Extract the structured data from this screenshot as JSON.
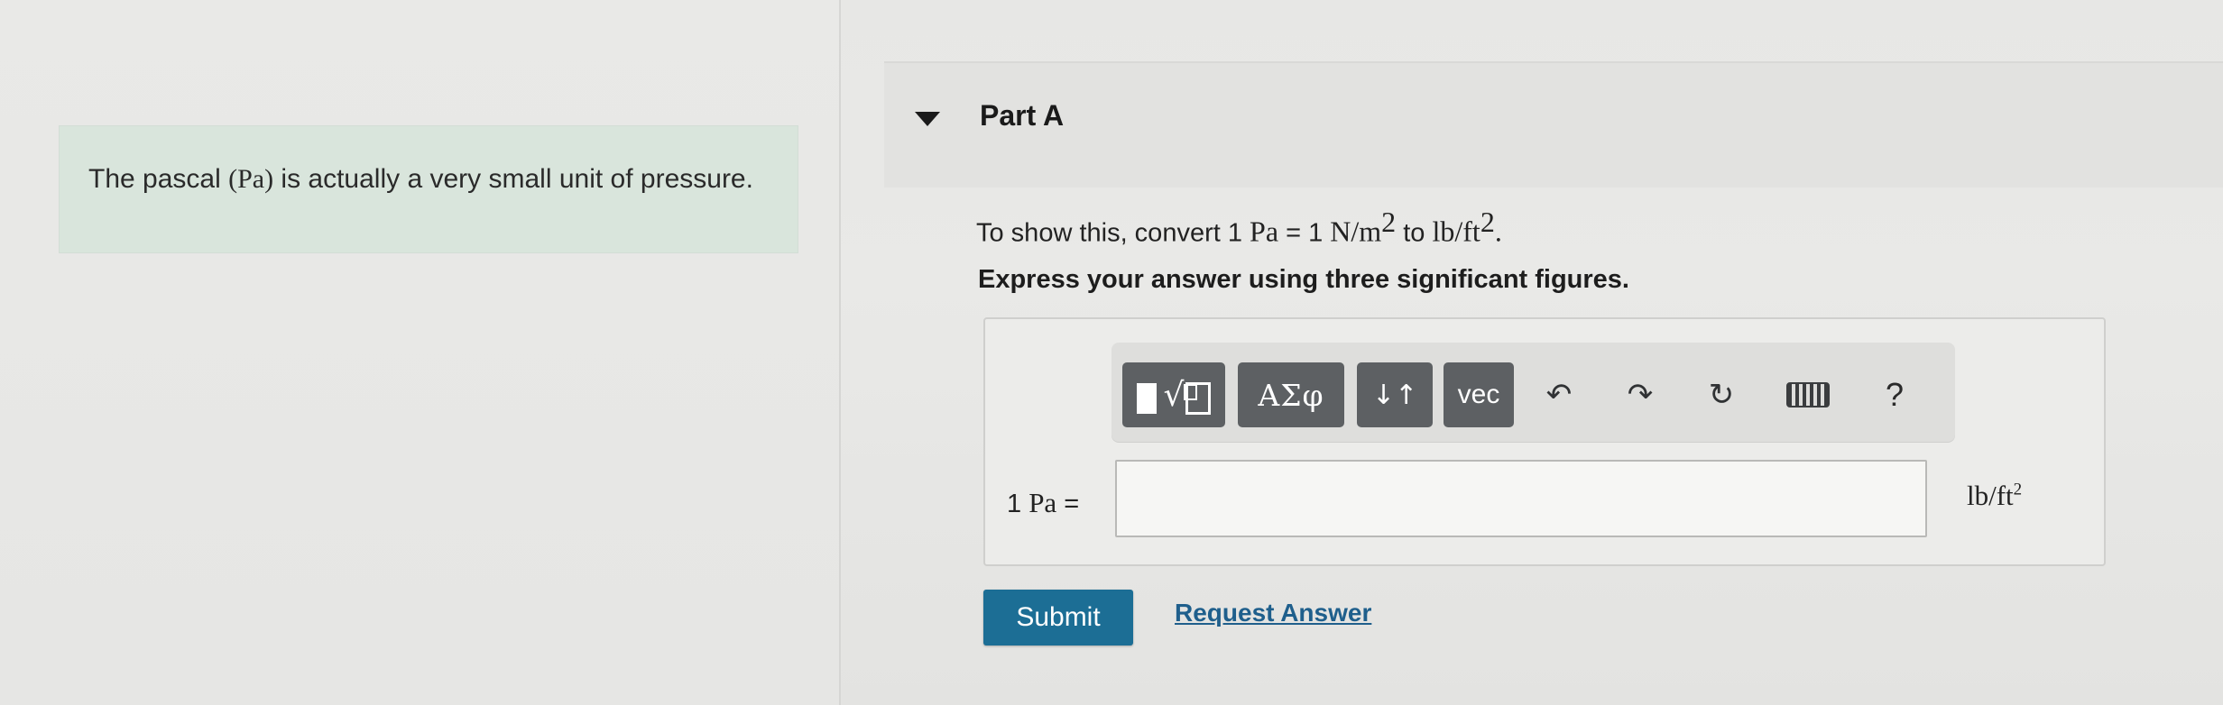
{
  "intro": {
    "text_before": "The pascal ",
    "unit_symbol": "(Pa)",
    "text_after": " is actually a very small unit of pressure."
  },
  "part": {
    "title": "Part A"
  },
  "question": {
    "prefix": "To show this, convert ",
    "lhs_number": "1 ",
    "lhs_unit": "Pa",
    "equals": " = ",
    "rhs_number": "1 ",
    "rhs_unit": "N/m",
    "rhs_exp": "2",
    "to_word": " to ",
    "target_unit": "lb/ft",
    "target_exp": "2",
    "period": "."
  },
  "instructions": "Express your answer using three significant figures.",
  "toolbar": {
    "templates_icon": "templates-icon",
    "greek_label": "ΑΣφ",
    "arrows_label": "↓↑",
    "vec_label": "vec",
    "undo_icon": "↶",
    "redo_icon": "↷",
    "reset_icon": "↻",
    "keyboard_icon": "keyboard-icon",
    "help_label": "?"
  },
  "answer": {
    "label_number": "1 ",
    "label_unit": "Pa",
    "label_equals": " =",
    "value": "",
    "unit": "lb/ft",
    "unit_exp": "2"
  },
  "actions": {
    "submit_label": "Submit",
    "request_answer_label": "Request Answer"
  },
  "colors": {
    "submit_bg": "#1c6e95",
    "link": "#1f5f8c",
    "intro_bg": "#d9e5dc",
    "toolbar_button": "#5d6063"
  }
}
